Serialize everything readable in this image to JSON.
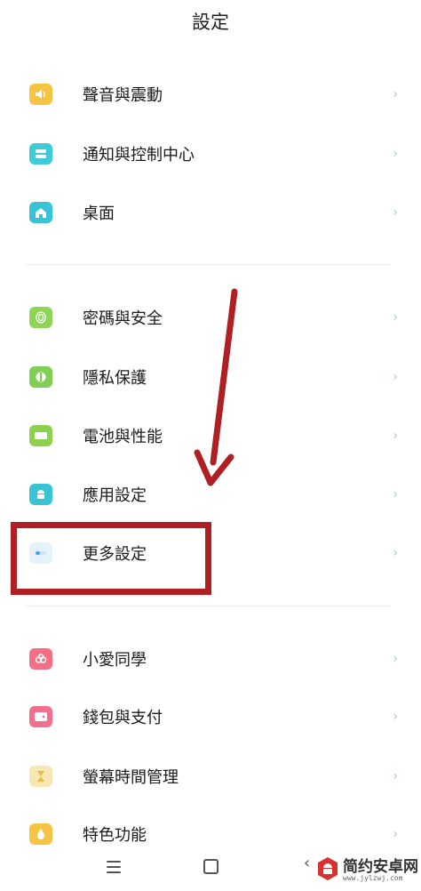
{
  "header": {
    "title": "設定"
  },
  "sections": [
    {
      "items": [
        {
          "label": "聲音與震動",
          "icon": "speaker-icon",
          "color": "#f6c445"
        },
        {
          "label": "通知與控制中心",
          "icon": "notification-icon",
          "color": "#3ecbd6"
        },
        {
          "label": "桌面",
          "icon": "home-icon",
          "color": "#36c4d6"
        }
      ]
    },
    {
      "items": [
        {
          "label": "密碼與安全",
          "icon": "fingerprint-icon",
          "color": "#8ed456"
        },
        {
          "label": "隱私保護",
          "icon": "privacy-icon",
          "color": "#7fcf55"
        },
        {
          "label": "電池與性能",
          "icon": "battery-icon",
          "color": "#8dd24d"
        },
        {
          "label": "應用設定",
          "icon": "android-icon",
          "color": "#39c4d4"
        },
        {
          "label": "更多設定",
          "icon": "more-settings-icon",
          "color": "#e6f2fa"
        }
      ]
    },
    {
      "items": [
        {
          "label": "小愛同學",
          "icon": "xiaoai-icon",
          "color": "#f36f86"
        },
        {
          "label": "錢包與支付",
          "icon": "wallet-icon",
          "color": "#f36f8e"
        },
        {
          "label": "螢幕時間管理",
          "icon": "hourglass-icon",
          "color": "#f7e7b5"
        },
        {
          "label": "特色功能",
          "icon": "feature-icon",
          "color": "#f6c445"
        }
      ]
    }
  ],
  "chevron": "›",
  "annotation": {
    "highlight_color": "#b01f24",
    "highlighted_item": "更多設定"
  },
  "navbar": {
    "back_glyph": "‹"
  },
  "watermark": {
    "text": "简约安卓网",
    "url": "www.jylzwj.com"
  }
}
